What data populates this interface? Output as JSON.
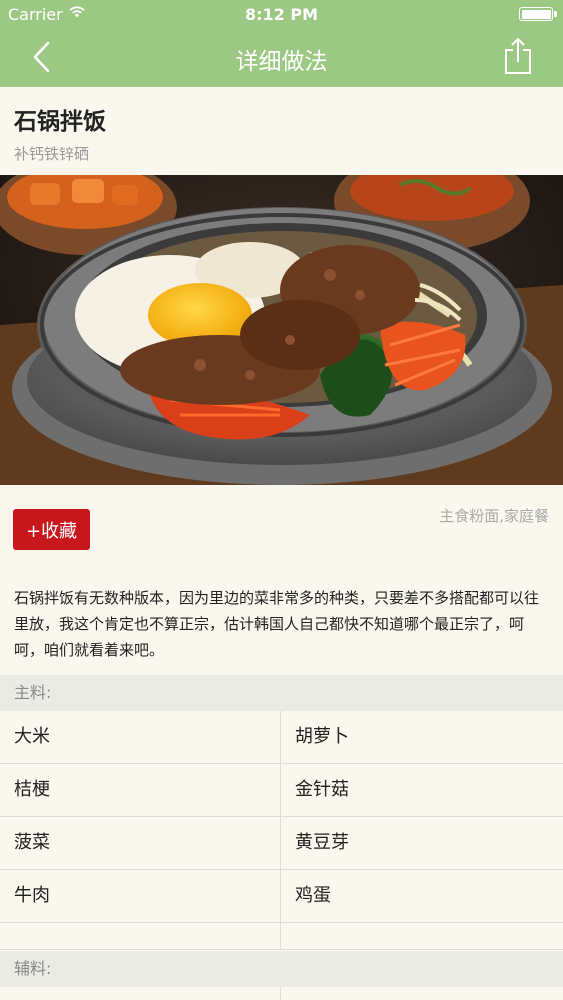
{
  "status_bar": {
    "carrier": "Carrier",
    "time": "8:12 PM"
  },
  "nav": {
    "title": "详细做法"
  },
  "recipe": {
    "name": "石锅拌饭",
    "subtitle": "补钙铁锌硒",
    "favorite_label": "+收藏",
    "category": "主食粉面,家庭餐",
    "description": "石锅拌饭有无数种版本，因为里边的菜非常多的种类，只要差不多搭配都可以往里放，我这个肯定也不算正宗，估计韩国人自己都快不知道哪个最正宗了，呵呵，咱们就看着来吧。"
  },
  "main_ingredients": {
    "header": "主料:",
    "items": [
      "大米",
      "胡萝卜",
      "桔梗",
      "金针菇",
      "菠菜",
      "黄豆芽",
      "牛肉",
      "鸡蛋"
    ]
  },
  "aux_ingredients": {
    "header": "辅料:"
  },
  "colors": {
    "nav_green": "#9bc882",
    "accent_red": "#c8161d",
    "background": "#faf7ee"
  }
}
